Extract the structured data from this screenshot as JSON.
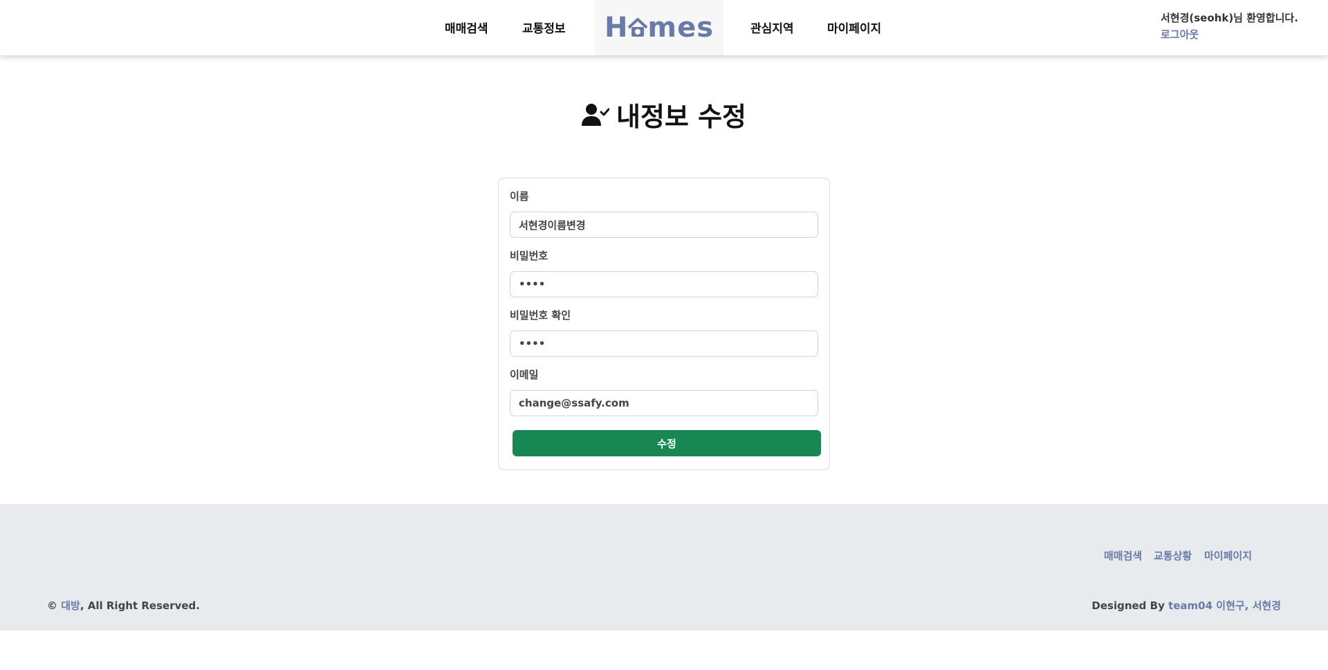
{
  "header": {
    "nav_left": [
      "매매검색",
      "교통정보"
    ],
    "logo": {
      "text_pre": "H",
      "text_post": "mes"
    },
    "nav_right": [
      "관심지역",
      "마이페이지"
    ],
    "welcome": "서현경(seohk)님 환영합니다.",
    "logout": "로그아웃"
  },
  "page": {
    "title": "내정보 수정",
    "title_icon": "user-check-icon"
  },
  "form": {
    "name_label": "이름",
    "name_value": "서현경이름변경",
    "password_label": "비밀번호",
    "password_value": "••••",
    "password_confirm_label": "비밀번호 확인",
    "password_confirm_value": "••••",
    "email_label": "이메일",
    "email_value": "change@ssafy.com",
    "submit_label": "수정"
  },
  "footer": {
    "links": [
      "매매검색",
      "교통상황",
      "마이페이지"
    ],
    "copyright_prefix": "© ",
    "copyright_brand": "대방",
    "copyright_suffix": ", All Right Reserved.",
    "designed_prefix": "Designed By ",
    "designed_team": "team04 이현구, 서현경"
  },
  "colors": {
    "brand": "#6a7aa8",
    "submit": "#198754",
    "footer_bg": "#e8ebee"
  }
}
